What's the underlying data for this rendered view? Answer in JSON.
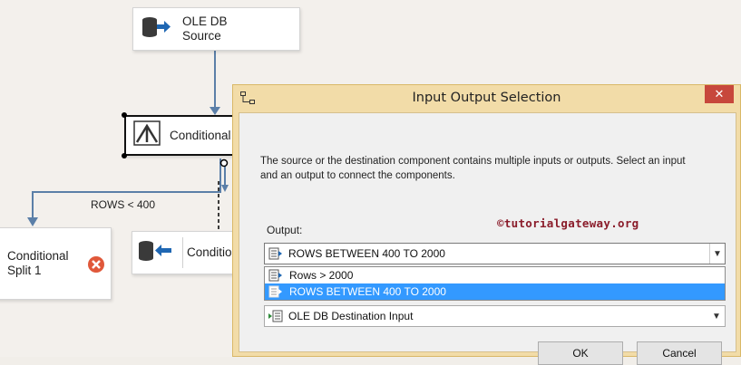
{
  "canvas": {
    "nodes": {
      "ole_db_source": {
        "line1": "OLE DB",
        "line2": "Source"
      },
      "conditional_split": {
        "label": "Conditional"
      },
      "conditional_split_1": {
        "line1": "Conditional",
        "line2": "Split 1"
      },
      "conditional_dest": {
        "label": "Condition"
      }
    },
    "path_label": "ROWS < 400"
  },
  "dialog": {
    "title": "Input Output Selection",
    "close_label": "✕",
    "description_line1": "The source or the destination component contains multiple inputs or outputs. Select an input",
    "description_line2": "and an output to connect the components.",
    "watermark": "©tutorialgateway.org",
    "output_label": "Output:",
    "output_selected": "ROWS BETWEEN 400 TO 2000",
    "output_options": [
      "Rows > 2000",
      "ROWS BETWEEN 400 TO 2000"
    ],
    "input_selected": "OLE DB Destination Input",
    "ok_label": "OK",
    "cancel_label": "Cancel"
  },
  "colors": {
    "dialog_frame": "#f2dca8",
    "close_button": "#c7473c",
    "selection": "#3399ff",
    "error_icon": "#e0583a",
    "path_line": "#5b7fa8"
  }
}
